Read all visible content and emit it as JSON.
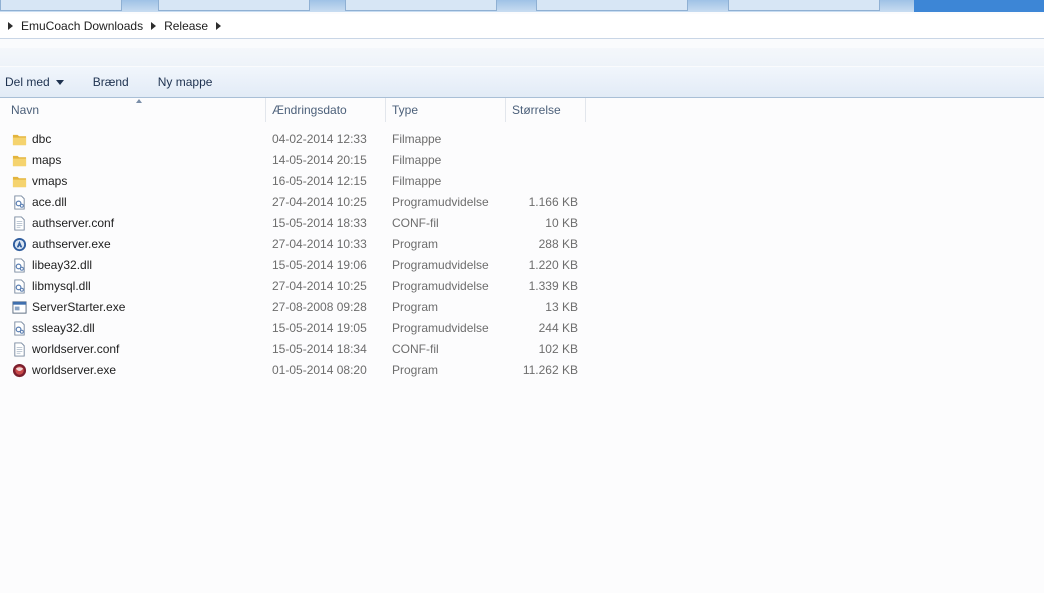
{
  "breadcrumb": [
    "EmuCoach Downloads",
    "Release"
  ],
  "toolbar": {
    "share": "Del med",
    "burn": "Brænd",
    "new_folder": "Ny mappe"
  },
  "columns": {
    "name": "Navn",
    "date": "Ændringsdato",
    "type": "Type",
    "size": "Størrelse"
  },
  "files": [
    {
      "name": "dbc",
      "date": "04-02-2014 12:33",
      "type": "Filmappe",
      "size": "",
      "icon": "folder-icon"
    },
    {
      "name": "maps",
      "date": "14-05-2014 20:15",
      "type": "Filmappe",
      "size": "",
      "icon": "folder-icon"
    },
    {
      "name": "vmaps",
      "date": "16-05-2014 12:15",
      "type": "Filmappe",
      "size": "",
      "icon": "folder-icon"
    },
    {
      "name": "ace.dll",
      "date": "27-04-2014 10:25",
      "type": "Programudvidelse",
      "size": "1.166 KB",
      "icon": "dll-icon"
    },
    {
      "name": "authserver.conf",
      "date": "15-05-2014 18:33",
      "type": "CONF-fil",
      "size": "10 KB",
      "icon": "text-file-icon"
    },
    {
      "name": "authserver.exe",
      "date": "27-04-2014 10:33",
      "type": "Program",
      "size": "288 KB",
      "icon": "authserver-app-icon"
    },
    {
      "name": "libeay32.dll",
      "date": "15-05-2014 19:06",
      "type": "Programudvidelse",
      "size": "1.220 KB",
      "icon": "dll-icon"
    },
    {
      "name": "libmysql.dll",
      "date": "27-04-2014 10:25",
      "type": "Programudvidelse",
      "size": "1.339 KB",
      "icon": "dll-icon"
    },
    {
      "name": "ServerStarter.exe",
      "date": "27-08-2008 09:28",
      "type": "Program",
      "size": "13 KB",
      "icon": "window-app-icon"
    },
    {
      "name": "ssleay32.dll",
      "date": "15-05-2014 19:05",
      "type": "Programudvidelse",
      "size": "244 KB",
      "icon": "dll-icon"
    },
    {
      "name": "worldserver.conf",
      "date": "15-05-2014 18:34",
      "type": "CONF-fil",
      "size": "102 KB",
      "icon": "text-file-icon"
    },
    {
      "name": "worldserver.exe",
      "date": "01-05-2014 08:20",
      "type": "Program",
      "size": "11.262 KB",
      "icon": "worldserver-app-icon"
    }
  ]
}
